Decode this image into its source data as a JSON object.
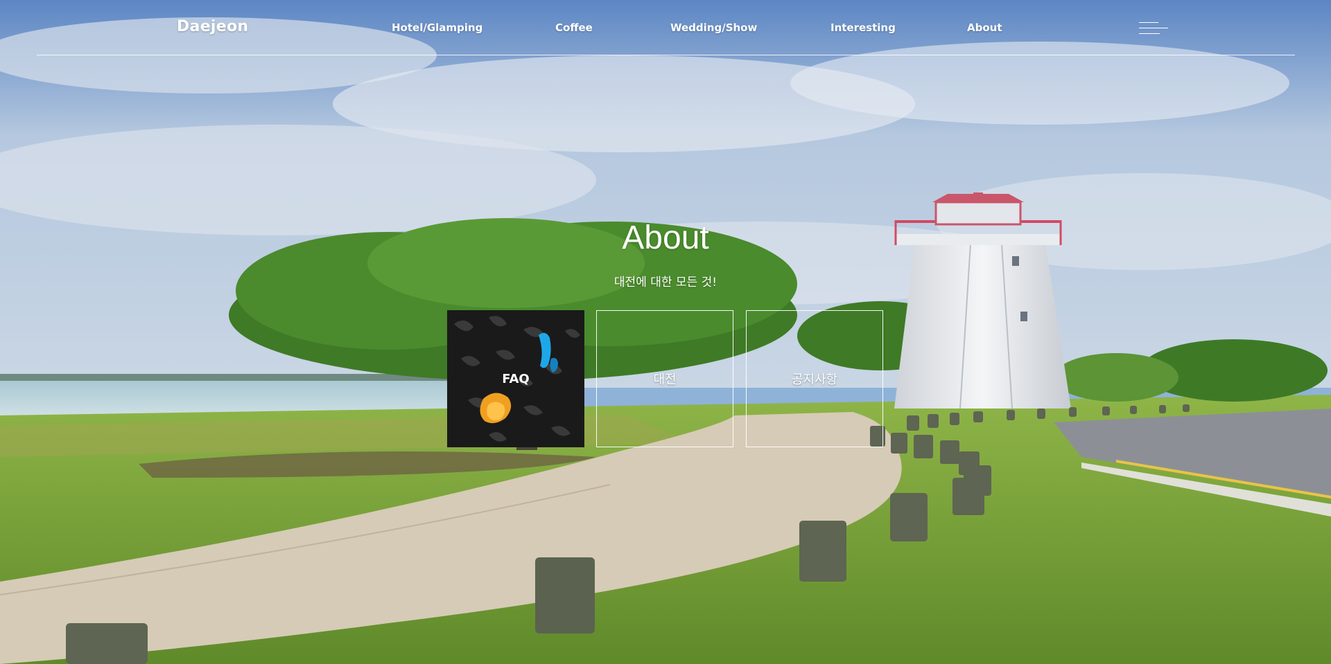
{
  "header": {
    "logo": "Daejeon",
    "nav": [
      {
        "label": "Hotel/Glamping"
      },
      {
        "label": "Coffee"
      },
      {
        "label": "Wedding/Show"
      },
      {
        "label": "Interesting"
      },
      {
        "label": "About"
      }
    ],
    "menu_icon": "hamburger-menu-icon"
  },
  "hero": {
    "title": "About",
    "subtitle": "대전에 대한 모든 것!"
  },
  "cards": [
    {
      "label": "FAQ"
    },
    {
      "label": "대전"
    },
    {
      "label": "공지사항"
    }
  ],
  "colors": {
    "text": "#ffffff",
    "sky": "#8fb2d8",
    "grass": "#6f9a35",
    "path": "#d6cbb6",
    "faq_bg": "#161616"
  }
}
